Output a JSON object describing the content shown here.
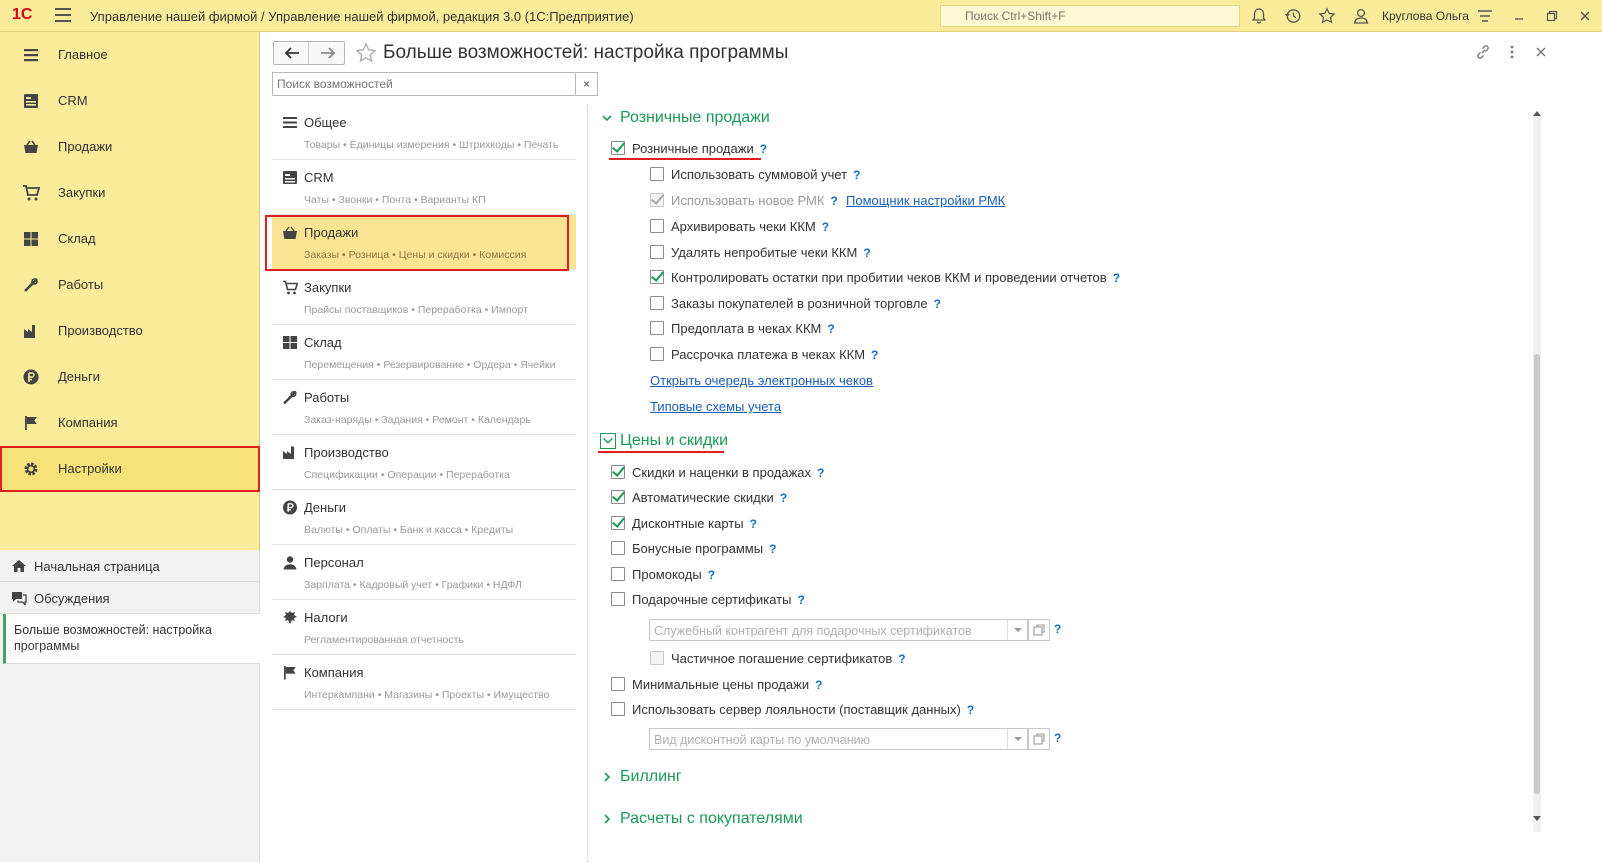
{
  "titlebar": {
    "logo": "1С",
    "title": "Управление нашей фирмой / Управление нашей фирмой, редакция 3.0  (1С:Предприятие)",
    "search_placeholder": "Поиск Ctrl+Shift+F",
    "user": "Круглова Ольга"
  },
  "sidebar": {
    "items": [
      {
        "label": "Главное",
        "icon": "list-icon"
      },
      {
        "label": "CRM",
        "icon": "crm-icon"
      },
      {
        "label": "Продажи",
        "icon": "basket-icon"
      },
      {
        "label": "Закупки",
        "icon": "cart-icon"
      },
      {
        "label": "Склад",
        "icon": "warehouse-icon"
      },
      {
        "label": "Работы",
        "icon": "tools-icon"
      },
      {
        "label": "Производство",
        "icon": "factory-icon"
      },
      {
        "label": "Деньги",
        "icon": "ruble-icon"
      },
      {
        "label": "Компания",
        "icon": "flag-icon"
      },
      {
        "label": "Настройки",
        "icon": "gear-icon"
      }
    ],
    "active_index": 9
  },
  "lower_nav": {
    "home": "Начальная страница",
    "discussions": "Обсуждения",
    "open_window": "Больше возможностей: настройка программы"
  },
  "header": {
    "title": "Больше возможностей: настройка программы"
  },
  "feature_search": {
    "placeholder": "Поиск возможностей",
    "clear": "×"
  },
  "sections": [
    {
      "title": "Общее",
      "sub": "Товары • Единицы измерения • Штрихкоды • Печать",
      "icon": "list-icon"
    },
    {
      "title": "CRM",
      "sub": "Чаты • Звонки • Почта • Варианты КП",
      "icon": "crm-icon"
    },
    {
      "title": "Продажи",
      "sub": "Заказы • Розница • Цены и скидки • Комиссия",
      "icon": "basket-icon"
    },
    {
      "title": "Закупки",
      "sub": "Прайсы поставщиков • Переработка • Импорт",
      "icon": "cart-icon"
    },
    {
      "title": "Склад",
      "sub": "Перемещения • Резервирование • Ордера • Ячейки",
      "icon": "warehouse-icon"
    },
    {
      "title": "Работы",
      "sub": "Заказ-наряды • Задания • Ремонт • Календарь",
      "icon": "tools-icon"
    },
    {
      "title": "Производство",
      "sub": "Спецификации • Операции • Переработка",
      "icon": "factory-icon"
    },
    {
      "title": "Деньги",
      "sub": "Валюты • Оплаты • Банк и касса • Кредиты",
      "icon": "ruble-icon"
    },
    {
      "title": "Персонал",
      "sub": "Зарплата • Кадровый учет • Графики • НДФЛ",
      "icon": "person-icon"
    },
    {
      "title": "Налоги",
      "sub": "Регламентированная отчетность",
      "icon": "emblem-icon"
    },
    {
      "title": "Компания",
      "sub": "Интеркампани • Магазины • Проекты • Имущество",
      "icon": "flag-icon"
    }
  ],
  "selected_section_index": 2,
  "retail": {
    "group_title": "Розничные продажи",
    "main_option": "Розничные продажи",
    "options": [
      {
        "label": "Использовать суммовой учет",
        "checked": false,
        "disabled": false
      },
      {
        "label": "Использовать новое РМК",
        "checked": true,
        "disabled": true
      },
      {
        "label": "Архивировать чеки ККМ",
        "checked": false,
        "disabled": false
      },
      {
        "label": "Удалять непробитые чеки ККМ",
        "checked": false,
        "disabled": false
      },
      {
        "label": "Контролировать остатки при пробитии чеков ККМ и проведении отчетов",
        "checked": true,
        "disabled": false
      },
      {
        "label": "Заказы покупателей в розничной торговле",
        "checked": false,
        "disabled": false
      },
      {
        "label": "Предоплата в чеках ККМ",
        "checked": false,
        "disabled": false
      },
      {
        "label": "Рассрочка платежа в чеках ККМ",
        "checked": false,
        "disabled": false
      }
    ],
    "rmk_helper_link": "Помощник настройки РМК",
    "link_queue": "Открыть очередь электронных чеков",
    "link_schemes": "Типовые схемы учета"
  },
  "prices": {
    "group_title": "Цены и скидки",
    "options": [
      {
        "label": "Скидки и наценки в продажах",
        "checked": true
      },
      {
        "label": "Автоматические скидки",
        "checked": true
      },
      {
        "label": "Дисконтные карты",
        "checked": true
      },
      {
        "label": "Бонусные программы",
        "checked": false
      },
      {
        "label": "Промокоды",
        "checked": false
      },
      {
        "label": "Подарочные сертификаты",
        "checked": false
      }
    ],
    "gift_counterparty_placeholder": "Служебный контрагент для подарочных сертификатов",
    "partial_redemption": "Частичное погашение сертификатов",
    "min_prices": "Минимальные цены продажи",
    "loyalty_server": "Использовать сервер лояльности (поставщик данных)",
    "card_type_placeholder": "Вид дисконтной карты по умолчанию"
  },
  "billing": {
    "group_title": "Биллинг"
  },
  "customers": {
    "group_title": "Расчеты с покупателями"
  },
  "help_mark": "?",
  "colors": {
    "accent_green": "#1b9a57",
    "sidebar_yellow": "#fbec9c",
    "highlight_red": "#e02020",
    "link_blue": "#1a5eb5"
  }
}
